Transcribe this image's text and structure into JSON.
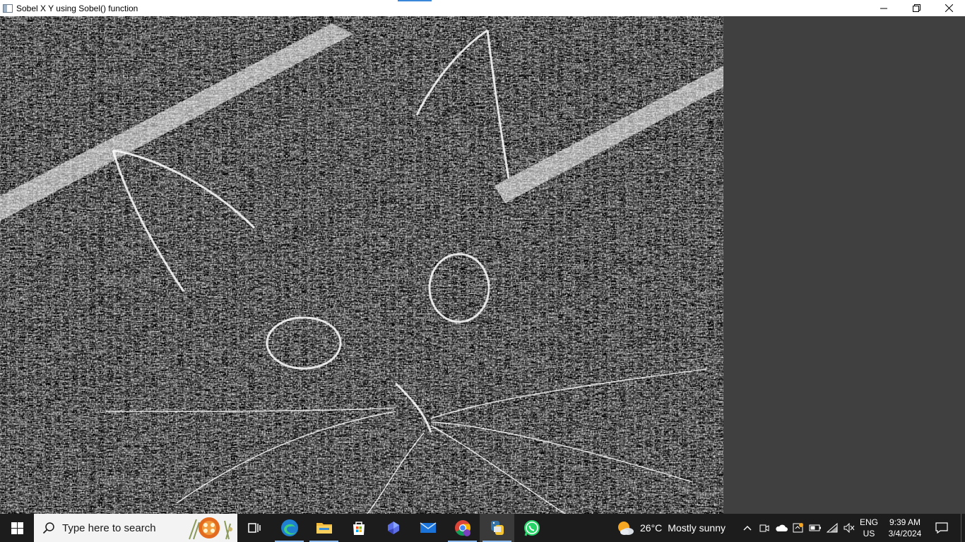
{
  "window": {
    "title": "Sobel X Y using Sobel() function",
    "image": {
      "description_icon": "edge-detected-cat-image",
      "background": "#000000",
      "foreground": "#ffffff"
    },
    "controls": {
      "minimize_icon": "minimize-icon",
      "restore_icon": "restore-icon",
      "close_icon": "close-icon"
    }
  },
  "taskbar": {
    "search_placeholder": "Type here to search",
    "pinned_icons": [
      "task-view-icon",
      "edge-icon",
      "file-explorer-icon",
      "microsoft-store-icon",
      "copilot-icon",
      "mail-icon",
      "chrome-icon",
      "python-icon",
      "whatsapp-icon"
    ],
    "weather": {
      "temperature": "26°C",
      "condition": "Mostly sunny"
    },
    "language": {
      "line1": "ENG",
      "line2": "US"
    },
    "clock": {
      "time": "9:39 AM",
      "date": "3/4/2024"
    },
    "colors": {
      "taskbar_bg": "#1c1c1c",
      "active_indicator": "#8ab8ec",
      "window_bg": "#404040"
    }
  }
}
